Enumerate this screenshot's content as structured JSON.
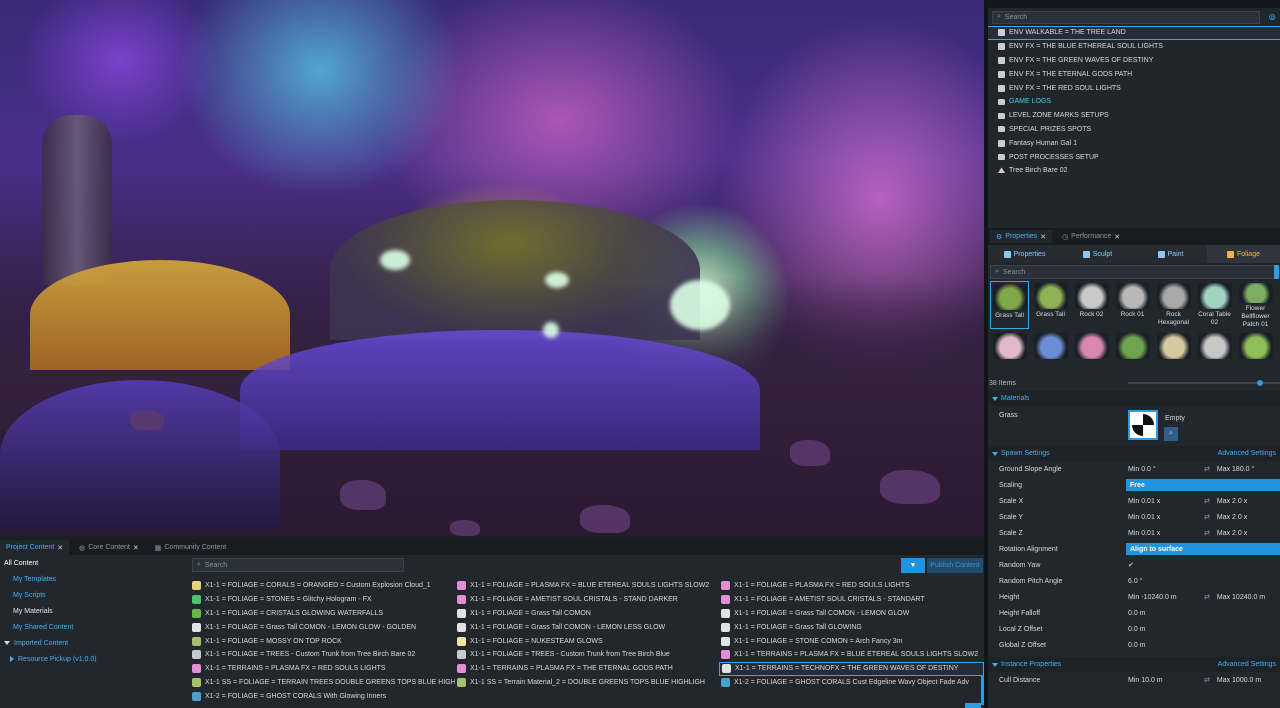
{
  "hierarchy": {
    "search_placeholder": "Search",
    "items": [
      {
        "label": "ENV WALKABLE = THE TREE LAND",
        "icon": "object",
        "selected": true
      },
      {
        "label": "ENV FX = THE BLUE ETHEREAL SOUL LIGHTS",
        "icon": "object"
      },
      {
        "label": "ENV FX = THE GREEN WAVES OF DESTINY",
        "icon": "object"
      },
      {
        "label": "ENV FX = THE ETERNAL GODS PATH",
        "icon": "object"
      },
      {
        "label": "ENV FX = THE RED SOUL LIGHTS",
        "icon": "object"
      },
      {
        "label": "GAME LOGS",
        "icon": "folder",
        "cyan": true
      },
      {
        "label": "LEVEL ZONE MARKS SETUPS",
        "icon": "folder"
      },
      {
        "label": "SPECIAL PRIZES SPOTS",
        "icon": "folder"
      },
      {
        "label": "Fantasy Human Gal 1",
        "icon": "object"
      },
      {
        "label": "POST PROCESSES SETUP",
        "icon": "folder"
      },
      {
        "label": "Tree Birch Bare 02",
        "icon": "tree"
      }
    ]
  },
  "props_tabs": {
    "properties": "Properties",
    "performance": "Performance"
  },
  "tools": {
    "properties": "Properties",
    "sculpt": "Sculpt",
    "paint": "Paint",
    "foliage": "Foliage"
  },
  "foliage": {
    "search_placeholder": "Search",
    "items_count": "38 Items",
    "assets": [
      {
        "label": "Grass Tall",
        "color": "#7fa84a"
      },
      {
        "label": "Grass Tall",
        "color": "#8fb256"
      },
      {
        "label": "Rock 02",
        "color": "#c9c9c9"
      },
      {
        "label": "Rock 01",
        "color": "#b8b8b8"
      },
      {
        "label": "Rock Hexagonal",
        "color": "#a8a8a8"
      },
      {
        "label": "Coral Table 02",
        "color": "#9fd4c3"
      },
      {
        "label": "Flower Bellflower Patch 01",
        "color": "#7cae62"
      },
      {
        "label": "",
        "color": "#e2b9c8"
      },
      {
        "label": "",
        "color": "#6b8fd6"
      },
      {
        "label": "",
        "color": "#d988b0"
      },
      {
        "label": "",
        "color": "#6fa44e"
      },
      {
        "label": "",
        "color": "#d6c9a2"
      },
      {
        "label": "",
        "color": "#c7c7c7"
      },
      {
        "label": "",
        "color": "#8fbf5a"
      }
    ]
  },
  "materials": {
    "section": "Materials",
    "grass_label": "Grass",
    "material_value": "Empty"
  },
  "spawn": {
    "section": "Spawn Settings",
    "advanced": "Advanced Settings",
    "ground_slope": {
      "label": "Ground Slope Angle",
      "min": "Min  0.0 °",
      "max": "Max  180.0 °"
    },
    "scaling": {
      "label": "Scaling",
      "value": "Free"
    },
    "scale_x": {
      "label": "Scale X",
      "min": "Min  0.01 x",
      "max": "Max  2.0 x"
    },
    "scale_y": {
      "label": "Scale Y",
      "min": "Min  0.01 x",
      "max": "Max  2.0 x"
    },
    "scale_z": {
      "label": "Scale Z",
      "min": "Min  0.01 x",
      "max": "Max  2.0 x"
    },
    "rotation": {
      "label": "Rotation Alignment",
      "value": "Align to surface"
    },
    "random_yaw": {
      "label": "Random Yaw",
      "value": "✔"
    },
    "random_pitch": {
      "label": "Random Pitch Angle",
      "value": "6.0 °"
    },
    "height": {
      "label": "Height",
      "min": "Min  -10240.0 m",
      "max": "Max  10240.0 m"
    },
    "height_falloff": {
      "label": "Height Falloff",
      "value": "0.0 m"
    },
    "local_z": {
      "label": "Local Z Offset",
      "value": "0.0 m"
    },
    "global_z": {
      "label": "Global Z Offset",
      "value": "0.0 m"
    }
  },
  "instance": {
    "section": "Instance Properties",
    "advanced": "Advanced Settings",
    "cull_distance": {
      "label": "Cull Distance",
      "min": "Min  10.0 m",
      "max": "Max  1000.0 m"
    }
  },
  "content": {
    "tabs": {
      "project": "Project Content",
      "core": "Core Content",
      "community": "Community Content"
    },
    "tree": {
      "all": "All Content",
      "templates": "My Templates",
      "scripts": "My Scripts",
      "materials": "My Materials",
      "shared": "My Shared Content",
      "imported": "Imported Content",
      "resource": "Resource Pickup (v1.0.0)"
    },
    "search_placeholder": "Search",
    "filter": "▼",
    "publish": "Publish Content",
    "items": [
      {
        "label": "X1-1 = FOLIAGE = CORALS = ORANGED = Custom Explosion Cloud_1",
        "color": "#e8d27a"
      },
      {
        "label": "X1-1 = FOLIAGE = PLASMA FX = BLUE ETEREAL SOULS LIGHTS SLOW2",
        "color": "#e38fd6"
      },
      {
        "label": "X1-1 = FOLIAGE = PLASMA FX = RED SOULS LIGHTS",
        "color": "#e38fd6"
      },
      {
        "label": "X1-1 = FOLIAGE = STONES = Glitchy Hologram - FX",
        "color": "#4fc36b"
      },
      {
        "label": "X1-1 = FOLIAGE = AMETIST SOUL CRISTALS - STAND DARKER",
        "color": "#e38fd6"
      },
      {
        "label": "X1-1 = FOLIAGE = AMETIST SOUL CRISTALS - STANDART",
        "color": "#e38fd6"
      },
      {
        "label": "X1-1 = FOLIAGE = CRISTALS GLOWING WATERFALLS",
        "color": "#62b84a"
      },
      {
        "label": "X1-1 = FOLIAGE = Grass Tall  COMON",
        "color": "#dfe3e6"
      },
      {
        "label": "X1-1 = FOLIAGE = Grass Tall  COMON - LEMON GLOW",
        "color": "#dfe3e6"
      },
      {
        "label": "X1-1 = FOLIAGE = Grass Tall  COMON - LEMON GLOW - GOLDEN",
        "color": "#dfe3e6"
      },
      {
        "label": "X1-1 = FOLIAGE = Grass Tall  COMON - LEMON LESS GLOW",
        "color": "#dfe3e6"
      },
      {
        "label": "X1-1 = FOLIAGE = Grass Tall  GLOWING",
        "color": "#dfe3e6"
      },
      {
        "label": "X1-1 = FOLIAGE = MOSSY ON TOP ROCK",
        "color": "#a8c06a"
      },
      {
        "label": "X1-1 = FOLIAGE = NUKESTEAM GLOWS",
        "color": "#f0e6a0"
      },
      {
        "label": "X1-1 = FOLIAGE = STONE COMON = Arch Fancy 3m",
        "color": "#dfe3e6"
      },
      {
        "label": "X1-1 = FOLIAGE = TREES - Custom Trunk from Tree Birch Bare 02",
        "color": "#c9c9c9"
      },
      {
        "label": "X1-1 = FOLIAGE = TREES - Custom Trunk from Tree Birch Blue",
        "color": "#c9c9c9"
      },
      {
        "label": "X1-1 = TERRAINS = PLASMA FX = BLUE ETEREAL SOULS LIGHTS SLOW2",
        "color": "#e38fd6"
      },
      {
        "label": "X1-1 = TERRAINS = PLASMA FX = RED SOULS LIGHTS",
        "color": "#e38fd6"
      },
      {
        "label": "X1-1 = TERRAINS = PLASMA FX = THE ETERNAL GODS PATH",
        "color": "#e38fd6"
      },
      {
        "label": "X1-1 = TERRAINS = TECHNOFX = THE GREEN WAVES OF DESTINY",
        "color": "#dfe3e6",
        "selected": true
      },
      {
        "label": "X1-1 SS = FOLIAGE = TERRAIN TREES DOUBLE GREENS TOPS BLUE HIGH",
        "color": "#a8c06a"
      },
      {
        "label": "X1-1 SS = Terrain Material_2 = DOUBLE GREENS TOPS BLUE HIGHLIGH",
        "color": "#a8c06a"
      },
      {
        "label": "X1-2 = FOLIAGE = GHOST CORALS Cust Edgeline Wavy Object Fade Adv",
        "color": "#4aa0c8"
      },
      {
        "label": "X1-2 = FOLIAGE = GHOST CORALS With Glowing Inners",
        "color": "#4aa0c8"
      }
    ]
  },
  "colors": {
    "accent": "#2094de",
    "selection": "#3aa6e8",
    "foliage_active": "#f0b44a"
  }
}
